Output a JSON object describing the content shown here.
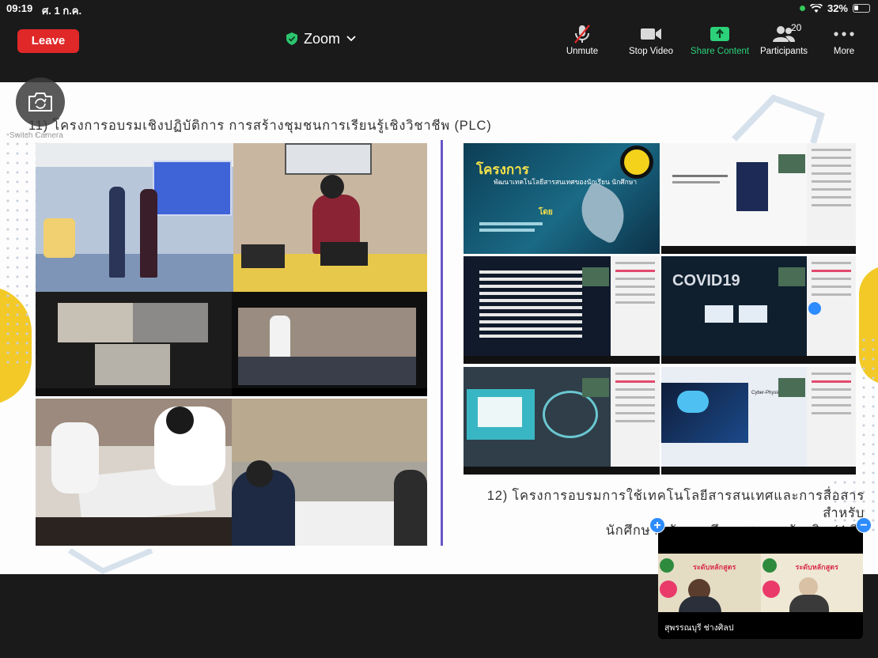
{
  "status_bar": {
    "time": "09:19",
    "date": "ศ. 1 ก.ค.",
    "battery": "32%",
    "battery_level": 0.32
  },
  "toolbar": {
    "leave_label": "Leave",
    "title": "Zoom",
    "buttons": [
      {
        "label": "Unmute",
        "icon": "microphone-muted-icon"
      },
      {
        "label": "Stop Video",
        "icon": "video-camera-icon"
      },
      {
        "label": "Share Content",
        "icon": "share-screen-icon"
      },
      {
        "label": "Participants",
        "icon": "participants-icon",
        "count": "20"
      },
      {
        "label": "More",
        "icon": "more-dots-icon"
      }
    ],
    "share_color": "#2cd17a",
    "leave_color": "#e02828"
  },
  "switch_camera": {
    "label": "Switch Camera",
    "icon": "switch-camera-icon"
  },
  "slide": {
    "heading_11": "11) โครงการอบรมเชิงปฏิบัติการ  การสร้างชุมชนการเรียนรู้เชิงวิชาชีพ (PLC)",
    "heading_12_line1": "12) โครงการอบรมการใช้เทคโนโลยีสารสนเทศและการสื่อสารสำหรับ",
    "heading_12_line2": "นักศึกษาหลักสูตรศึกษาศาสตรบัณฑิต (4 ปี)",
    "poster_title": "โครงการ",
    "poster_subtitle": "พัฒนาเทคโนโลยีสารสนเทศของนักเรียน นักศึกษา",
    "poster_by": "โดย",
    "covid_text": "COVID19",
    "cyber_text": "Cyber-Physical Model",
    "accent_purple": "#6a55c7",
    "accent_yellow": "#f3c928"
  },
  "video_tile": {
    "participant_name": "สุพรรณบุรี ช่างศิลป",
    "banner_text": "ระดับหลักสูตร",
    "zoom_in_icon": "plus-icon",
    "zoom_out_icon": "minus-icon"
  }
}
